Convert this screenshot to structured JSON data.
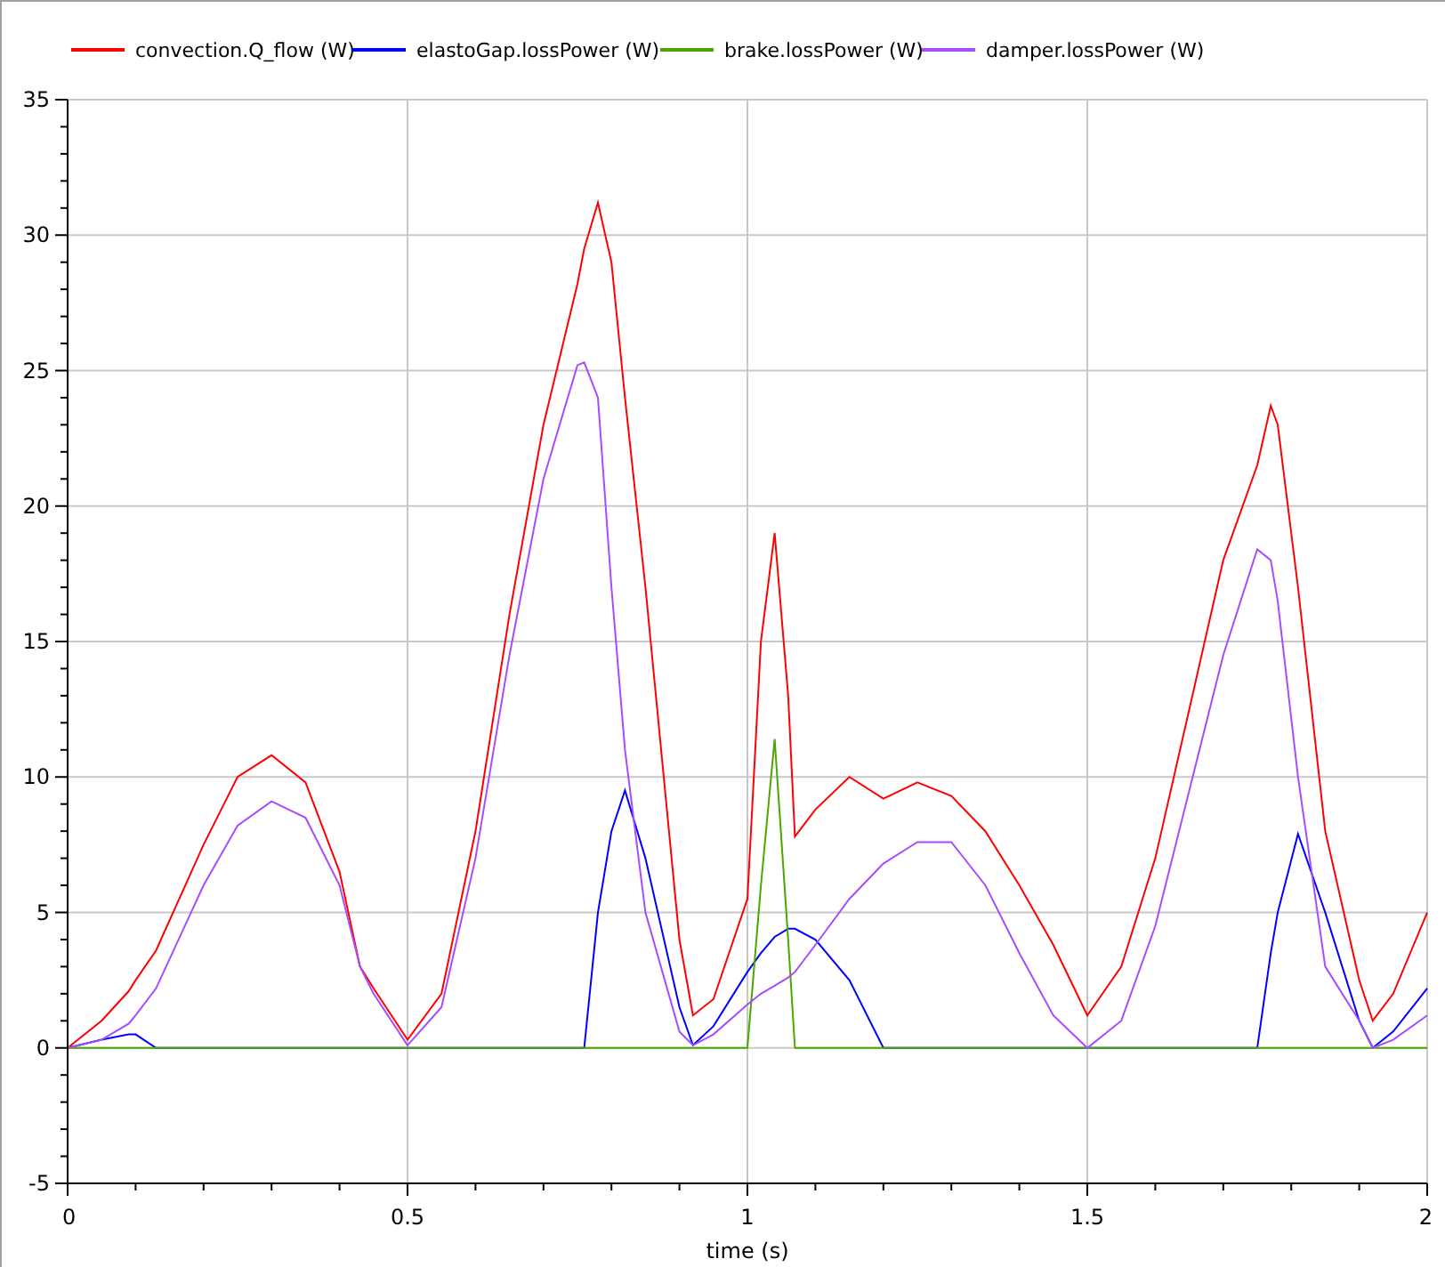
{
  "plot": {
    "chart_data": {
      "type": "line",
      "grid": true,
      "legend": "top",
      "xlabel": "time (s)",
      "xlim": [
        0,
        2
      ],
      "ylim": [
        -5,
        35
      ],
      "xticks": [
        0,
        0.5,
        1,
        1.5,
        2
      ],
      "yticks": [
        -5,
        0,
        5,
        10,
        15,
        20,
        25,
        30,
        35
      ],
      "x": [
        0,
        0.05,
        0.09,
        0.1,
        0.13,
        0.2,
        0.25,
        0.3,
        0.35,
        0.4,
        0.43,
        0.45,
        0.5,
        0.55,
        0.6,
        0.65,
        0.7,
        0.75,
        0.76,
        0.78,
        0.8,
        0.82,
        0.85,
        0.9,
        0.92,
        0.95,
        1,
        1.02,
        1.04,
        1.06,
        1.07,
        1.1,
        1.15,
        1.2,
        1.25,
        1.3,
        1.35,
        1.4,
        1.45,
        1.5,
        1.55,
        1.6,
        1.65,
        1.7,
        1.75,
        1.77,
        1.78,
        1.81,
        1.85,
        1.9,
        1.92,
        1.95,
        2
      ],
      "series": [
        {
          "name": "convection.Q_flow (W)",
          "color": "#ff0000",
          "values": [
            0,
            1,
            2.1,
            2.5,
            3.6,
            7.5,
            10,
            10.8,
            9.8,
            6.5,
            3,
            2.2,
            0.3,
            2,
            8,
            16,
            23,
            28.2,
            29.5,
            31.2,
            29,
            24,
            17,
            4,
            1.2,
            1.8,
            5.5,
            15,
            19,
            13,
            7.8,
            8.8,
            10,
            9.2,
            9.8,
            9.3,
            8,
            6,
            3.8,
            1.2,
            3,
            7,
            12.5,
            18,
            21.5,
            23.7,
            23,
            17,
            8,
            2.5,
            1,
            2,
            5
          ]
        },
        {
          "name": "elastoGap.lossPower (W)",
          "color": "#0000ff",
          "values": [
            0,
            0.3,
            0.5,
            0.5,
            0,
            0,
            0,
            0,
            0,
            0,
            0,
            0,
            0,
            0,
            0,
            0,
            0,
            0,
            0,
            5,
            8,
            9.5,
            7,
            1.5,
            0.1,
            0.8,
            2.8,
            3.5,
            4.1,
            4.4,
            4.4,
            4,
            2.5,
            0,
            0,
            0,
            0,
            0,
            0,
            0,
            0,
            0,
            0,
            0,
            0,
            3.5,
            5,
            7.9,
            5,
            1,
            0,
            0.6,
            2.2
          ]
        },
        {
          "name": "brake.lossPower (W)",
          "color": "#4ca600",
          "values": [
            0,
            0,
            0,
            0,
            0,
            0,
            0,
            0,
            0,
            0,
            0,
            0,
            0,
            0,
            0,
            0,
            0,
            0,
            0,
            0,
            0,
            0,
            0,
            0,
            0,
            0,
            0,
            6,
            11.4,
            4,
            0,
            0,
            0,
            0,
            0,
            0,
            0,
            0,
            0,
            0,
            0,
            0,
            0,
            0,
            0,
            0,
            0,
            0,
            0,
            0,
            0,
            0,
            0
          ]
        },
        {
          "name": "damper.lossPower (W)",
          "color": "#a64cff",
          "values": [
            0,
            0.3,
            0.9,
            1.2,
            2.2,
            6,
            8.2,
            9.1,
            8.5,
            6,
            3,
            2,
            0.1,
            1.5,
            7,
            14.5,
            21,
            25.2,
            25.3,
            24,
            17,
            11,
            5,
            0.6,
            0.1,
            0.5,
            1.6,
            2,
            2.3,
            2.6,
            2.8,
            3.8,
            5.5,
            6.8,
            7.6,
            7.6,
            6,
            3.5,
            1.2,
            0,
            1,
            4.5,
            9.5,
            14.5,
            18.4,
            18,
            16.5,
            10,
            3,
            1,
            0,
            0.3,
            1.2
          ]
        }
      ]
    }
  }
}
